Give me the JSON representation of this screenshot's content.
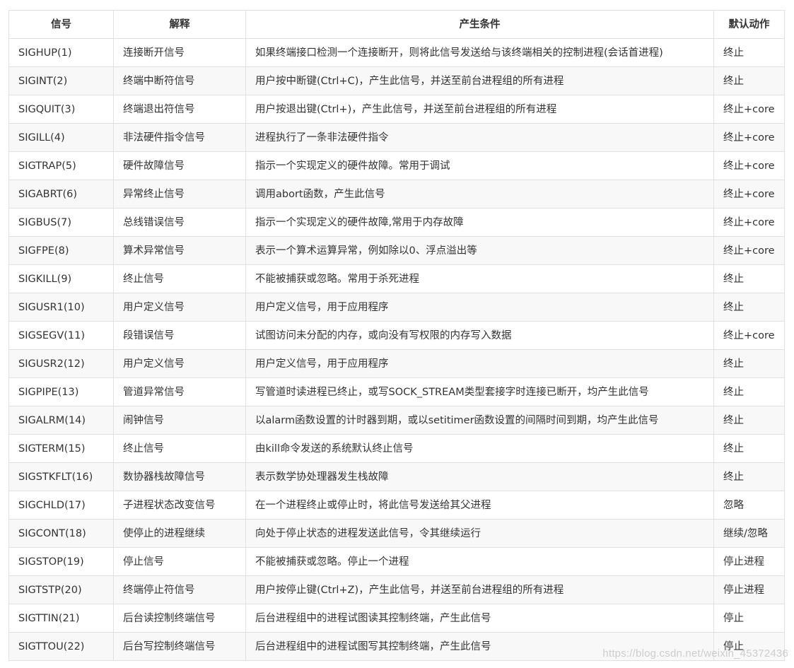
{
  "table": {
    "headers": [
      "信号",
      "解释",
      "产生条件",
      "默认动作"
    ],
    "rows": [
      [
        "SIGHUP(1)",
        "连接断开信号",
        "如果终端接口检测一个连接断开，则将此信号发送给与该终端相关的控制进程(会话首进程)",
        "终止"
      ],
      [
        "SIGINT(2)",
        "终端中断符信号",
        "用户按中断键(Ctrl+C)，产生此信号，并送至前台进程组的所有进程",
        "终止"
      ],
      [
        "SIGQUIT(3)",
        "终端退出符信号",
        "用户按退出键(Ctrl+)，产生此信号，并送至前台进程组的所有进程",
        "终止+core"
      ],
      [
        "SIGILL(4)",
        "非法硬件指令信号",
        "进程执行了一条非法硬件指令",
        "终止+core"
      ],
      [
        "SIGTRAP(5)",
        "硬件故障信号",
        "指示一个实现定义的硬件故障。常用于调试",
        "终止+core"
      ],
      [
        "SIGABRT(6)",
        "异常终止信号",
        "调用abort函数，产生此信号",
        "终止+core"
      ],
      [
        "SIGBUS(7)",
        "总线错误信号",
        "指示一个实现定义的硬件故障,常用于内存故障",
        "终止+core"
      ],
      [
        "SIGFPE(8)",
        "算术异常信号",
        "表示一个算术运算异常，例如除以0、浮点溢出等",
        "终止+core"
      ],
      [
        "SIGKILL(9)",
        "终止信号",
        "不能被捕获或忽略。常用于杀死进程",
        "终止"
      ],
      [
        "SIGUSR1(10)",
        "用户定义信号",
        "用户定义信号，用于应用程序",
        "终止"
      ],
      [
        "SIGSEGV(11)",
        "段错误信号",
        "试图访问未分配的内存，或向没有写权限的内存写入数据",
        "终止+core"
      ],
      [
        "SIGUSR2(12)",
        "用户定义信号",
        "用户定义信号，用于应用程序",
        "终止"
      ],
      [
        "SIGPIPE(13)",
        "管道异常信号",
        "写管道时读进程已终止，或写SOCK_STREAM类型套接字时连接已断开，均产生此信号",
        "终止"
      ],
      [
        "SIGALRM(14)",
        "闹钟信号",
        "以alarm函数设置的计时器到期，或以setitimer函数设置的间隔时间到期，均产生此信号",
        "终止"
      ],
      [
        "SIGTERM(15)",
        "终止信号",
        "由kill命令发送的系统默认终止信号",
        "终止"
      ],
      [
        "SIGSTKFLT(16)",
        "数协器栈故障信号",
        "表示数学协处理器发生栈故障",
        "终止"
      ],
      [
        "SIGCHLD(17)",
        "子进程状态改变信号",
        "在一个进程终止或停止时，将此信号发送给其父进程",
        "忽略"
      ],
      [
        "SIGCONT(18)",
        "使停止的进程继续",
        "向处于停止状态的进程发送此信号，令其继续运行",
        "继续/忽略"
      ],
      [
        "SIGSTOP(19)",
        "停止信号",
        "不能被捕获或忽略。停止一个进程",
        "停止进程"
      ],
      [
        "SIGTSTP(20)",
        "终端停止符信号",
        "用户按停止键(Ctrl+Z)，产生此信号，并送至前台进程组的所有进程",
        "停止进程"
      ],
      [
        "SIGTTIN(21)",
        "后台读控制终端信号",
        "后台进程组中的进程试图读其控制终端，产生此信号",
        "停止"
      ],
      [
        "SIGTTOU(22)",
        "后台写控制终端信号",
        "后台进程组中的进程试图写其控制终端，产生此信号",
        "停止"
      ]
    ]
  },
  "watermark": "https://blog.csdn.net/weixin_45372436"
}
